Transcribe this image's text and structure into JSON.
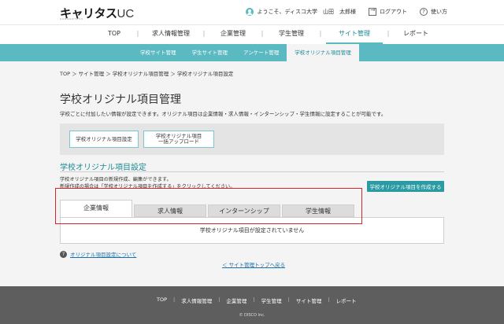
{
  "header": {
    "logo_main": "キャリタス",
    "logo_uc": "UC",
    "logo_sub": "CAREERTASU",
    "welcome_text": "ようこそ、ディスコ大学　山田　太郎様",
    "logout_label": "ログアウト",
    "help_label": "使い方"
  },
  "main_nav": {
    "items": [
      {
        "label": "TOP"
      },
      {
        "label": "求人情報管理"
      },
      {
        "label": "企業管理"
      },
      {
        "label": "学生管理"
      },
      {
        "label": "サイト管理"
      },
      {
        "label": "レポート"
      }
    ],
    "separator": "|",
    "active_index": 4
  },
  "sub_nav": {
    "items": [
      {
        "label": "学校サイト管理"
      },
      {
        "label": "学生サイト管理"
      },
      {
        "label": "アンケート管理"
      },
      {
        "label": "学校オリジナル項目管理"
      }
    ],
    "active_index": 3
  },
  "breadcrumb": "TOP ＞ サイト管理 ＞ 学校オリジナル項目管理 ＞ 学校オリジナル項目設定",
  "page_title": "学校オリジナル項目管理",
  "page_description": "学校ごとに付加したい情報が設定できます。オリジナル項目は企業情報・求人情報・インターンシップ・学生情報に設定することが可能です。",
  "tools": {
    "button1": "学校オリジナル項目設定",
    "button2_line1": "学校オリジナル項目",
    "button2_line2": "一括アップロード"
  },
  "section": {
    "title": "学校オリジナル項目設定",
    "desc_line1": "学校オリジナル項目の新規作成、編集ができます。",
    "desc_line2": "新規作成の場合は「学校オリジナル項目を作成する」をクリックしてください。",
    "create_button": "学校オリジナル項目を作成する"
  },
  "tabs": [
    {
      "label": "企業情報"
    },
    {
      "label": "求人情報"
    },
    {
      "label": "インターンシップ"
    },
    {
      "label": "学生情報"
    }
  ],
  "active_tab": 0,
  "empty_message": "学校オリジナル項目が設定されていません",
  "help_link": "オリジナル項目設定について",
  "help_icon_glyph": "?",
  "back_link": "＜ サイト管理トップへ戻る",
  "footer": {
    "items": [
      {
        "label": "TOP"
      },
      {
        "label": "求人情報管理"
      },
      {
        "label": "企業管理"
      },
      {
        "label": "学生管理"
      },
      {
        "label": "サイト管理"
      },
      {
        "label": "レポート"
      }
    ],
    "separator": "|",
    "copyright": "© DISCO Inc."
  },
  "colors": {
    "accent": "#5bb9c2",
    "accent_dark": "#1c8a92",
    "button": "#2a9aa3",
    "annotation_red": "#d7262a",
    "footer_bg": "#5e5e5e"
  }
}
